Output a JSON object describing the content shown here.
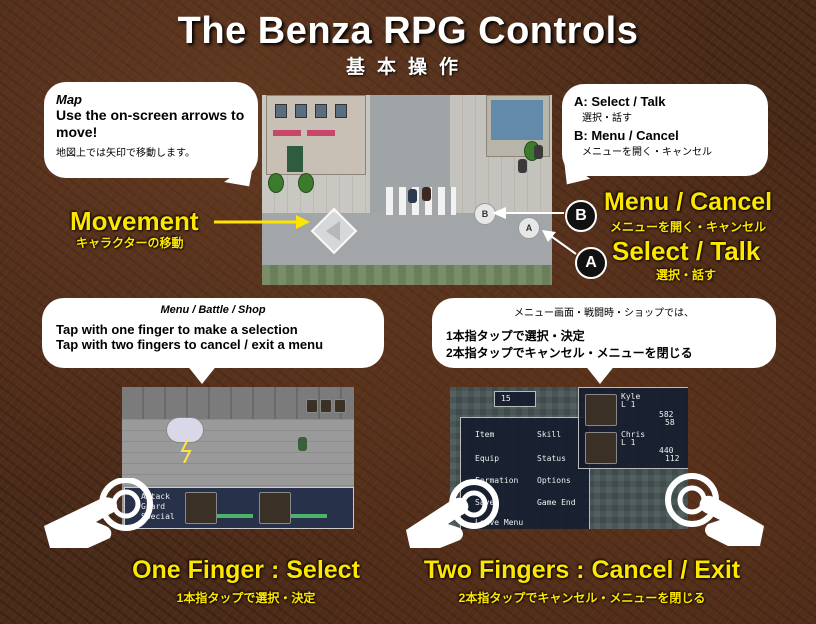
{
  "title": "The Benza RPG Controls",
  "subtitle": "基本操作",
  "map_bubble": {
    "heading": "Map",
    "line": "Use the on-screen arrows to move!",
    "jp": "地図上では矢印で移動します。"
  },
  "buttons_bubble": {
    "a_label": "A: Select / Talk",
    "a_jp": "選択・話す",
    "b_label": "B: Menu / Cancel",
    "b_jp": "メニューを開く・キャンセル"
  },
  "movement": {
    "label": "Movement",
    "jp": "キャラクターの移動"
  },
  "menu_cancel": {
    "letter": "B",
    "label": "Menu / Cancel",
    "jp": "メニューを開く・キャンセル"
  },
  "select_talk": {
    "letter": "A",
    "label": "Select / Talk",
    "jp": "選択・話す"
  },
  "map_screen": {
    "btn_b": "B",
    "btn_a": "A"
  },
  "left_bubble": {
    "heading": "Menu / Battle / Shop",
    "line1": "Tap with one finger to make a selection",
    "line2": "Tap with two fingers to cancel / exit a menu"
  },
  "right_bubble": {
    "heading": "メニュー画面・戦闘時・ショップでは、",
    "line1": "1本指タップで選択・決定",
    "line2": "2本指タップでキャンセル・メニューを閉じる"
  },
  "battle_screen": {
    "commands": [
      "Attack",
      "Guard",
      "Special"
    ]
  },
  "menu_screen": {
    "gold": "15",
    "items": [
      "Item",
      "Skill",
      "Equip",
      "Status",
      "Formation",
      "Options",
      "Save",
      "Game End",
      "Leave Menu"
    ],
    "char1": {
      "name": "Kyle",
      "level": "L 1",
      "hp": "582",
      "mp": "58"
    },
    "char2": {
      "name": "Chris",
      "level": "L 1",
      "hp": "440",
      "mp": "112"
    }
  },
  "one_finger": {
    "label": "One Finger : Select",
    "jp": "1本指タップで選択・決定"
  },
  "two_fingers": {
    "label": "Two Fingers : Cancel / Exit",
    "jp": "2本指タップでキャンセル・メニューを閉じる"
  },
  "colors": {
    "accent": "#ffe600",
    "background": "#4a2a18"
  },
  "icons": [
    "gesture-hand-icon",
    "tap-ring-icon",
    "arrow-dpad-icon"
  ]
}
